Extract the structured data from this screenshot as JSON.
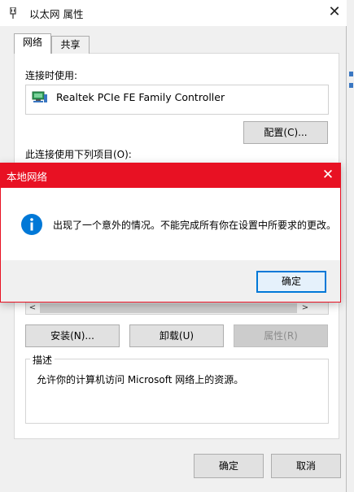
{
  "window": {
    "title": "以太网 属性",
    "close_glyph": "✕"
  },
  "tabs": [
    {
      "label": "网络"
    },
    {
      "label": "共享"
    }
  ],
  "network": {
    "connect_using_label": "连接时使用:",
    "adapter_name": "Realtek PCIe FE Family Controller",
    "config_button": "配置(C)...",
    "items_label": "此连接使用下列项目(O):",
    "scroll_left_glyph": "<",
    "scroll_right_glyph": ">",
    "install_button": "安装(N)...",
    "uninstall_button": "卸载(U)",
    "properties_button": "属性(R)",
    "description_title": "描述",
    "description_text": "允许你的计算机访问 Microsoft 网络上的资源。"
  },
  "footer": {
    "ok_button": "确定",
    "cancel_button": "取消"
  },
  "modal": {
    "title": "本地网络",
    "close_glyph": "✕",
    "icon": "info-icon",
    "message": "出现了一个意外的情况。不能完成所有你在设置中所要求的更改。",
    "ok_button": "确定"
  },
  "colors": {
    "modal_accent": "#e81123",
    "info_icon": "#0078d7",
    "focus_border": "#0078d7"
  }
}
